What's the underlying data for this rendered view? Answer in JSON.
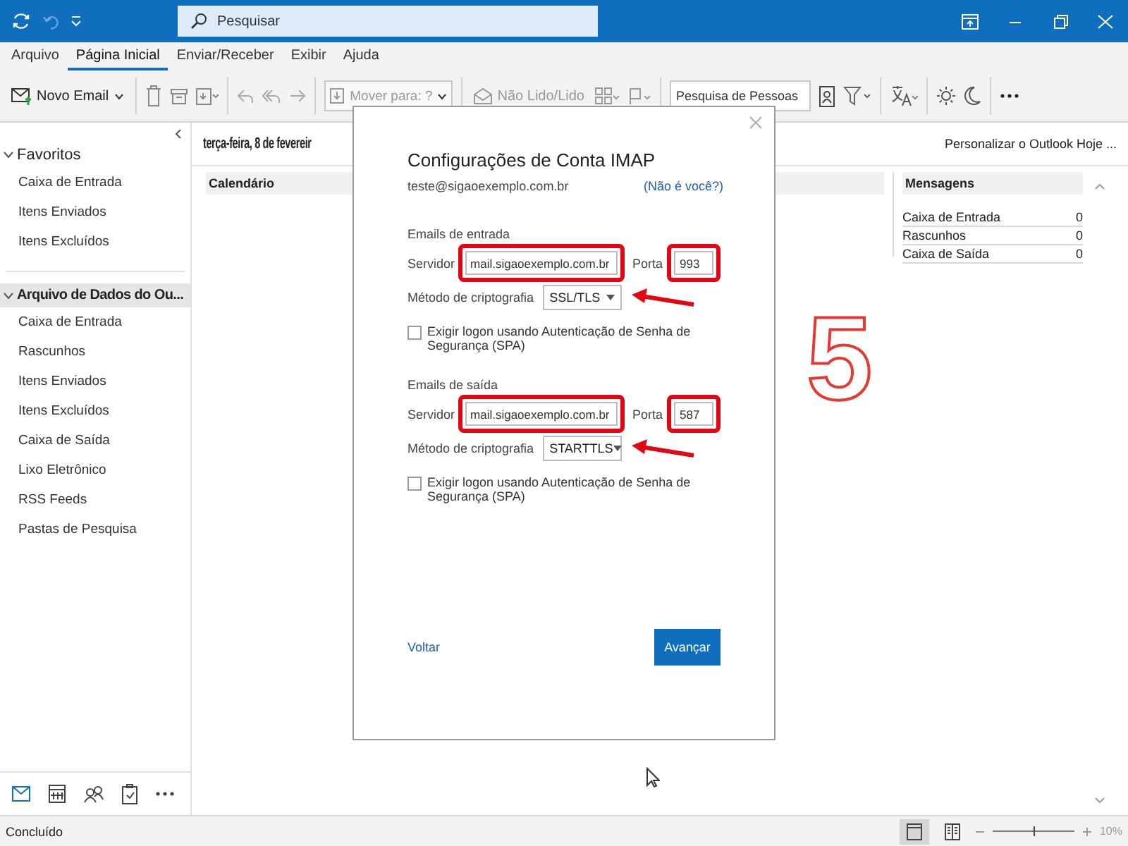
{
  "title_bar": {
    "search": {
      "placeholder": "Pesquisar"
    }
  },
  "menu_tabs": [
    {
      "label": "Arquivo",
      "selected": false
    },
    {
      "label": "Página Inicial",
      "selected": true
    },
    {
      "label": "Enviar/Receber",
      "selected": false
    },
    {
      "label": "Exibir",
      "selected": false
    },
    {
      "label": "Ajuda",
      "selected": false
    }
  ],
  "ribbon": {
    "new_email": "Novo Email",
    "move_to": {
      "label": "Mover para: ?",
      "disabled": true
    },
    "read_unread": {
      "label": "Não Lido/Lido",
      "disabled": true
    },
    "people_search": {
      "placeholder": "Pesquisa de Pessoas"
    }
  },
  "sidebar": {
    "groups": [
      {
        "label": "Favoritos",
        "expanded": true,
        "selected": false,
        "items": [
          {
            "label": "Caixa de Entrada"
          },
          {
            "label": "Itens Enviados"
          },
          {
            "label": "Itens Excluídos"
          }
        ]
      },
      {
        "label": "Arquivo de Dados do Ou...",
        "expanded": true,
        "selected": true,
        "items": [
          {
            "label": "Caixa de Entrada"
          },
          {
            "label": "Rascunhos"
          },
          {
            "label": "Itens Enviados"
          },
          {
            "label": "Itens Excluídos"
          },
          {
            "label": "Caixa de Saída"
          },
          {
            "label": "Lixo Eletrônico"
          },
          {
            "label": "RSS Feeds"
          },
          {
            "label": "Pastas de Pesquisa"
          }
        ]
      }
    ]
  },
  "nav": [
    {
      "kind": "mail",
      "selected": true
    },
    {
      "kind": "calendar",
      "selected": false
    },
    {
      "kind": "people",
      "selected": false
    },
    {
      "kind": "tasks",
      "selected": false
    },
    {
      "kind": "more",
      "selected": false
    }
  ],
  "today": {
    "date": "terça-feira, 8 de fevereir",
    "customize_link": "Personalizar o Outlook Hoje ...",
    "calendar_heading": "Calendário",
    "messages": {
      "heading": "Mensagens",
      "rows": [
        {
          "name": "Caixa de Entrada",
          "count": "0"
        },
        {
          "name": "Rascunhos",
          "count": "0"
        },
        {
          "name": "Caixa de Saída",
          "count": "0"
        }
      ]
    }
  },
  "dialog": {
    "title": "Configurações de Conta IMAP",
    "email": "teste@sigaoexemplo.com.br",
    "not_you_link": "(Não é você?)",
    "sections": [
      {
        "heading": "Emails de entrada",
        "server_label": "Servidor",
        "server": "mail.sigaoexemplo.com.br",
        "server_highlighted": true,
        "port_label": "Porta",
        "port": "993",
        "port_highlighted": true,
        "encryption_label": "Método de criptografia",
        "encryption": "SSL/TLS",
        "encryption_arrow": true,
        "spa_label": "Exigir logon usando Autenticação de Senha de Segurança (SPA)",
        "spa_checked": false
      },
      {
        "heading": "Emails de saída",
        "server_label": "Servidor",
        "server": "mail.sigaoexemplo.com.br",
        "server_highlighted": true,
        "port_label": "Porta",
        "port": "587",
        "port_highlighted": true,
        "encryption_label": "Método de criptografia",
        "encryption": "STARTTLS",
        "encryption_arrow": true,
        "spa_label": "Exigir logon usando Autenticação de Senha de Segurança (SPA)",
        "spa_checked": false
      }
    ],
    "back_link": "Voltar",
    "next_button": "Avançar"
  },
  "annotation": {
    "step": "5"
  },
  "status_bar": {
    "status": "Concluído",
    "zoom": {
      "level": 0.5,
      "reading": "10%"
    }
  }
}
